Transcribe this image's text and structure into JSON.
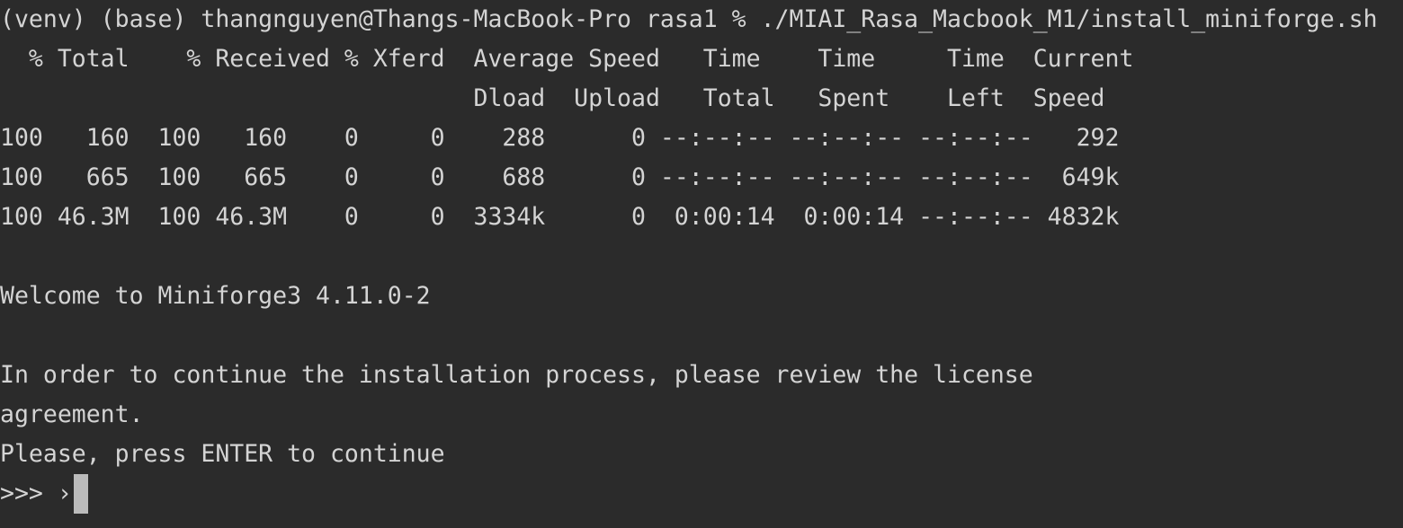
{
  "terminal": {
    "lines": [
      "(venv) (base) thangnguyen@Thangs-MacBook-Pro rasa1 % ./MIAI_Rasa_Macbook_M1/install_miniforge.sh",
      "  % Total    % Received % Xferd  Average Speed   Time    Time     Time  Current",
      "                                 Dload  Upload   Total   Spent    Left  Speed",
      "100   160  100   160    0     0    288      0 --:--:-- --:--:-- --:--:--   292",
      "100   665  100   665    0     0    688      0 --:--:-- --:--:-- --:--:--  649k",
      "100 46.3M  100 46.3M    0     0  3334k      0  0:00:14  0:00:14 --:--:-- 4832k",
      "",
      "Welcome to Miniforge3 4.11.0-2",
      "",
      "In order to continue the installation process, please review the license",
      "agreement.",
      "Please, press ENTER to continue"
    ],
    "prompt": ">>> ›"
  }
}
